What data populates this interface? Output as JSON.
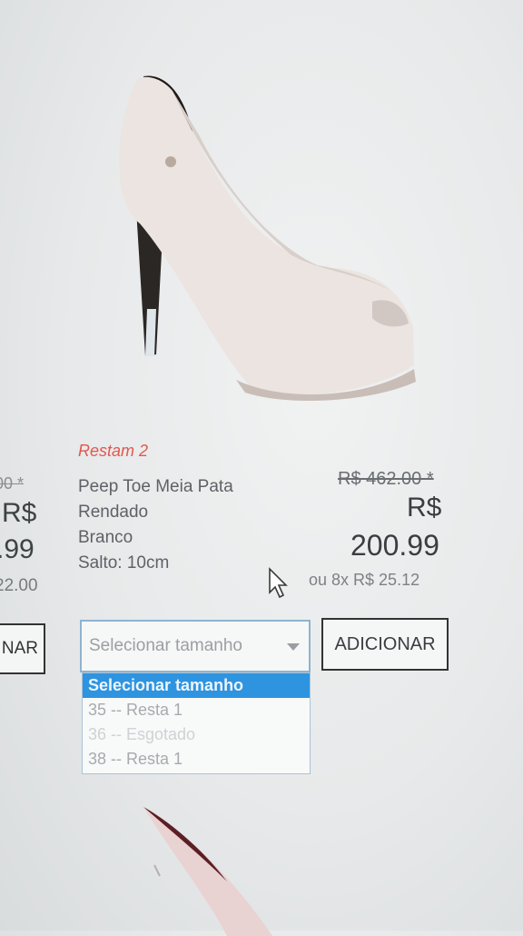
{
  "left_product": {
    "old_price": "00 *",
    "currency": "R$",
    "price": ".99",
    "installments": "22.00",
    "button_label": "NAR"
  },
  "product": {
    "stock_note": "Restam 2",
    "name_lines": [
      "Peep Toe Meia Pata",
      "Rendado",
      "Branco",
      "Salto: 10cm"
    ],
    "old_price": "R$ 462.00 *",
    "currency": "R$",
    "price": "200.99",
    "installments": "ou 8x R$ 25.12"
  },
  "size_select": {
    "value": "Selecionar tamanho",
    "options": [
      {
        "label": "Selecionar tamanho",
        "state": "selected"
      },
      {
        "label": "35 -- Resta 1",
        "state": "normal"
      },
      {
        "label": "36 -- Esgotado",
        "state": "disabled"
      },
      {
        "label": "38 -- Resta 1",
        "state": "normal"
      }
    ]
  },
  "add_button": "ADICIONAR",
  "colors": {
    "accent_select_blue": "#2e94e0",
    "stock_red": "#e2574f"
  }
}
